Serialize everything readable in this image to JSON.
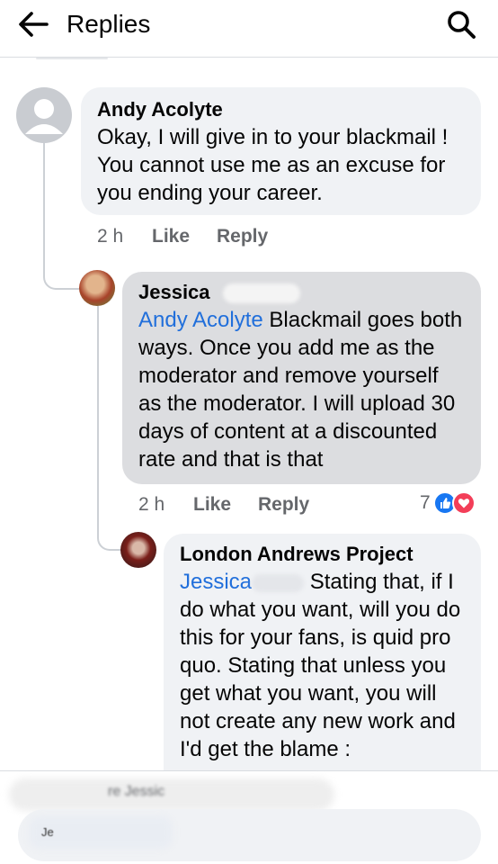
{
  "header": {
    "title": "Replies",
    "back_icon": "arrow-left-icon",
    "search_icon": "search-icon"
  },
  "comments": [
    {
      "author": "Andy Acolyte",
      "text": "Okay, I will give in to your blackmail ! You cannot use me as an excuse for you ending your career.",
      "time": "2 h",
      "like_label": "Like",
      "reply_label": "Reply"
    },
    {
      "author": "Jessica",
      "mention": "Andy Acolyte",
      "text": "Blackmail goes both ways. Once you add me as the moderator and remove yourself as the moderator. I will upload 30 days of content at a discounted rate and that is that",
      "time": "2 h",
      "like_label": "Like",
      "reply_label": "Reply",
      "reaction_count": "7",
      "reaction_icons": [
        "like-icon",
        "love-icon"
      ],
      "colors": {
        "like": "#1877f2",
        "love": "#f33e58"
      }
    },
    {
      "author": "London Andrews Project",
      "mention": "Jessica",
      "text": "Stating that, if I do what you want, will you do this for your fans, is quid pro quo. Stating that unless you get what you want, you will not create any new work and I'd get the blame :"
    }
  ],
  "composer": {
    "replying_to": "re Jessic",
    "input_text": "Je"
  },
  "colors": {
    "bubble": "#f0f2f5",
    "highlighted_bubble": "#dcdde0",
    "mention": "#216fdb",
    "meta_text": "#65676b"
  }
}
